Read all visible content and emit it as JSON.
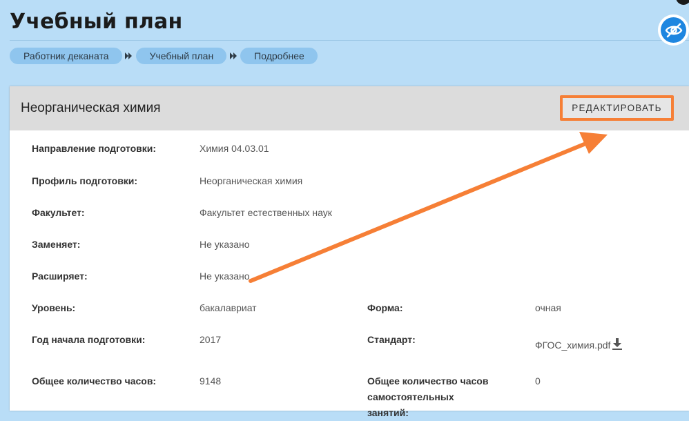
{
  "header": {
    "title": "Учебный план",
    "breadcrumb": [
      "Работник деканата",
      "Учебный план",
      "Подробнее"
    ]
  },
  "card": {
    "title": "Неорганическая химия",
    "edit_label": "РЕДАКТИРОВАТЬ",
    "fields": {
      "direction": {
        "label": "Направление подготовки:",
        "value": "Химия 04.03.01"
      },
      "profile": {
        "label": "Профиль подготовки:",
        "value": "Неорганическая химия"
      },
      "faculty": {
        "label": "Факультет:",
        "value": "Факультет естественных наук"
      },
      "replaces": {
        "label": "Заменяет:",
        "value": "Не указано"
      },
      "extends": {
        "label": "Расширяет:",
        "value": "Не указано"
      },
      "level": {
        "label": "Уровень:",
        "value": "бакалавриат"
      },
      "form": {
        "label": "Форма:",
        "value": "очная"
      },
      "start_year": {
        "label": "Год начала подготовки:",
        "value": "2017"
      },
      "standard": {
        "label": "Стандарт:",
        "value": "ФГОС_химия.pdf"
      },
      "total_hours": {
        "label": "Общее количество часов:",
        "value": "9148"
      },
      "self_hours": {
        "label_line1": "Общее количество часов",
        "label_line2": "самостоятельных",
        "label_line3": "занятий:",
        "value": "0"
      }
    }
  },
  "colors": {
    "header_bg": "#b9ddf7",
    "crumb_bg": "#8fc5ee",
    "accent_orange": "#f67f36",
    "eye_button": "#1e86e0"
  },
  "icons": [
    "chevron-right-icon",
    "eye-slash-icon",
    "download-icon",
    "chat-icon"
  ]
}
